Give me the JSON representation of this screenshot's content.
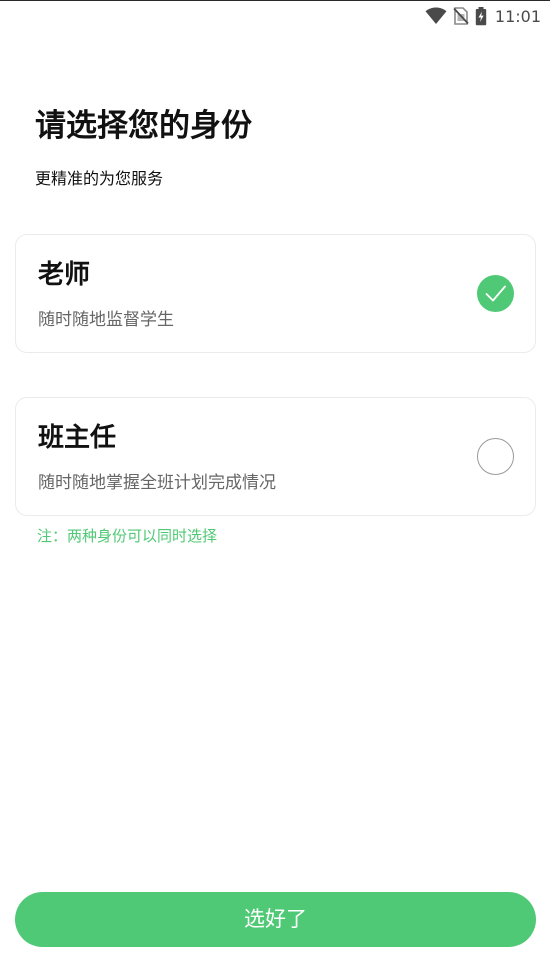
{
  "status_bar": {
    "time": "11:01",
    "icons": [
      "wifi-icon",
      "no-sim-icon",
      "battery-charging-icon"
    ]
  },
  "header": {
    "title": "请选择您的身份",
    "subtitle": "更精准的为您服务"
  },
  "roles": [
    {
      "title": "老师",
      "description": "随时随地监督学生",
      "selected": true
    },
    {
      "title": "班主任",
      "description": "随时随地掌握全班计划完成情况",
      "selected": false
    }
  ],
  "note": "注：两种身份可以同时选择",
  "confirm_button": {
    "label": "选好了"
  },
  "colors": {
    "accent": "#4fc975",
    "text_primary": "#111111",
    "text_secondary": "#666666",
    "card_border": "#ebebeb"
  }
}
